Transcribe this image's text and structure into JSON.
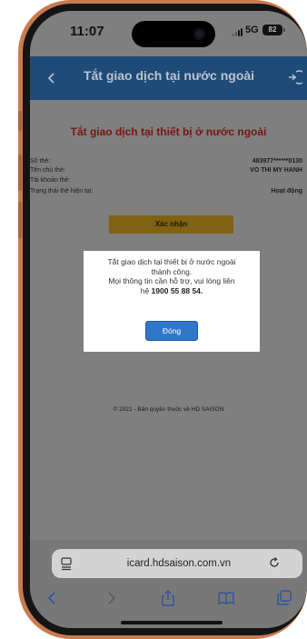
{
  "status_bar": {
    "time": "11:07",
    "network": "5G",
    "battery": "82"
  },
  "header": {
    "title": "Tắt giao dịch tại nước ngoài",
    "back_icon": "chevron-left-icon",
    "logout_icon": "logout-icon",
    "color": "#1f4b78"
  },
  "card": {
    "heading": "Tắt giao dịch tại thiết bị ở nước ngoài",
    "rows": [
      {
        "label": "Số thẻ:",
        "value": "483977******0130"
      },
      {
        "label": "Tên chủ thẻ:",
        "value": "VO THI MY HANH"
      },
      {
        "label": "Tài khoản thẻ:",
        "value": ""
      },
      {
        "label": "Trạng thái thẻ hiện tại:",
        "value": "Hoạt động"
      }
    ],
    "confirm_label": "Xác nhận",
    "confirm_color": "#7f6213"
  },
  "modal": {
    "line1": "Tắt giao dịch tại thiết bị ở nước ngoài",
    "line2": "thành công.",
    "line3": "Mọi thông tin cần hỗ trợ, vui lòng liên",
    "line4_prefix": "hệ ",
    "hotline": "1900 55 88 54",
    "line4_suffix": ".",
    "close_label": "Đóng",
    "close_color": "#2f78c9"
  },
  "footer": {
    "copyright": "© 2021 - Bản quyền thuộc về HD SAISON"
  },
  "browser": {
    "url": "icard.hdsaison.com.vn",
    "icons": [
      "site-settings-icon",
      "reload-icon",
      "back-icon",
      "forward-icon",
      "share-icon",
      "bookmarks-icon",
      "tabs-icon"
    ]
  }
}
